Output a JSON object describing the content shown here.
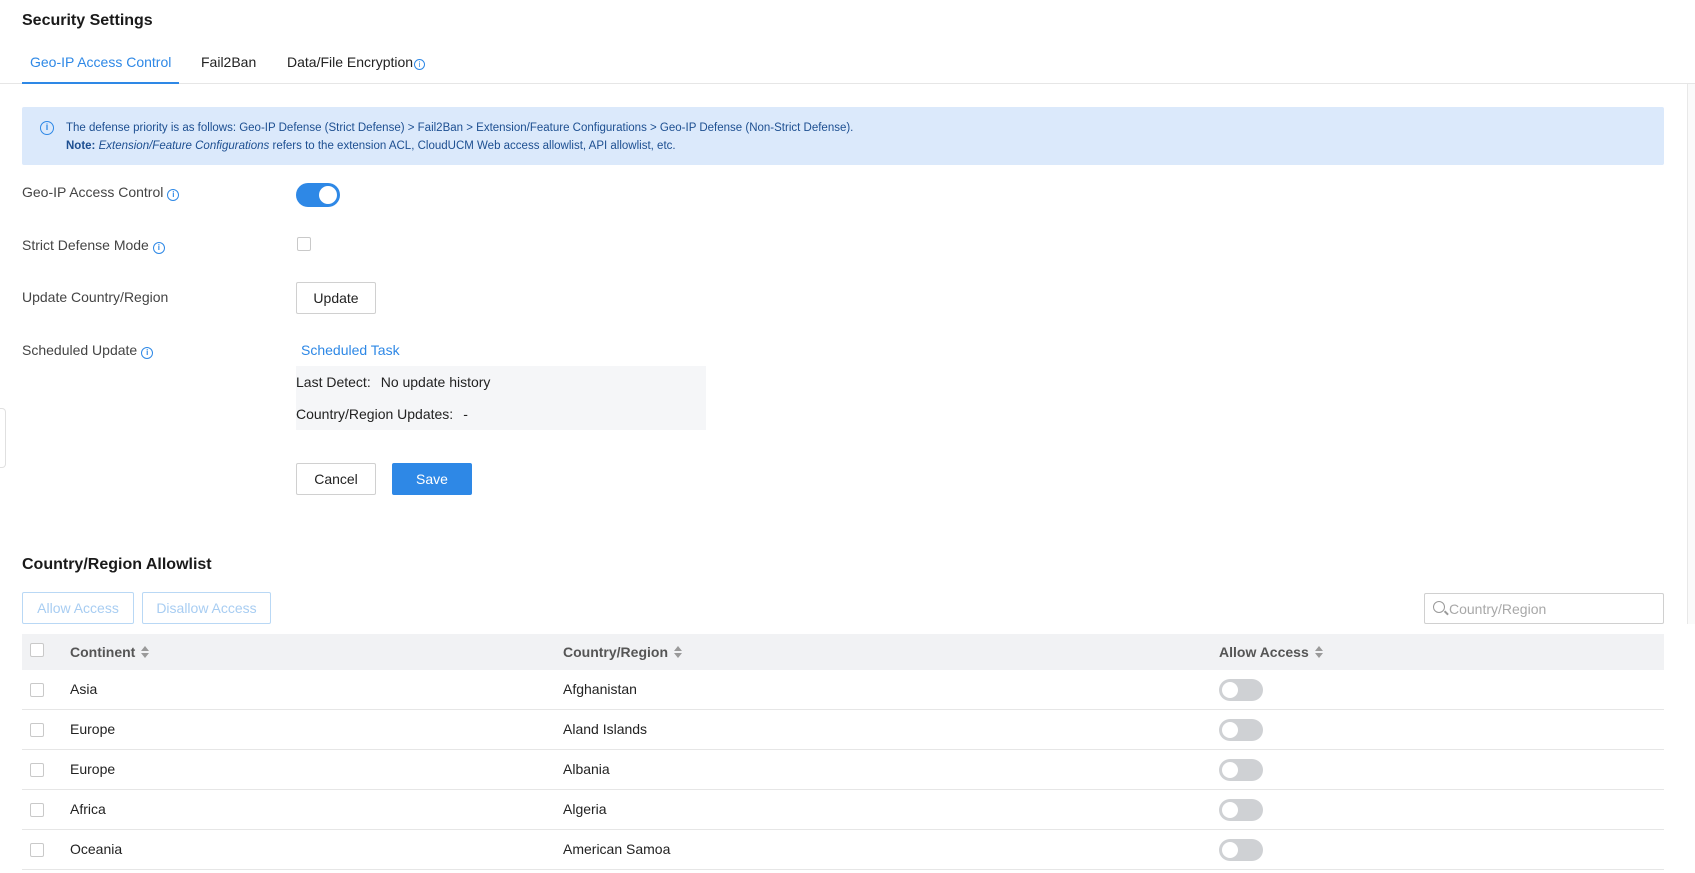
{
  "page": {
    "title": "Security Settings"
  },
  "tabs": [
    {
      "label": "Geo-IP Access Control"
    },
    {
      "label": "Fail2Ban"
    },
    {
      "label": "Data/File Encryption"
    }
  ],
  "notice": {
    "line1": "The defense priority is as follows: Geo-IP Defense (Strict Defense) > Fail2Ban > Extension/Feature Configurations > Geo-IP Defense (Non-Strict Defense).",
    "note_label": "Note:",
    "note_term": "Extension/Feature Configurations",
    "note_rest": "refers to the extension ACL, CloudUCM Web access allowlist, API allowlist, etc."
  },
  "form": {
    "geo_ip_label": "Geo-IP Access Control",
    "geo_ip_enabled": true,
    "strict_label": "Strict Defense Mode",
    "strict_checked": false,
    "update_label": "Update Country/Region",
    "update_button": "Update",
    "scheduled_label": "Scheduled Update",
    "scheduled_link": "Scheduled Task",
    "last_detect_label": "Last Detect:",
    "last_detect_value": "No update history",
    "updates_label": "Country/Region Updates:",
    "updates_value": "-",
    "cancel_button": "Cancel",
    "save_button": "Save"
  },
  "allowlist": {
    "title": "Country/Region Allowlist",
    "allow_button": "Allow Access",
    "disallow_button": "Disallow Access",
    "search_placeholder": "Country/Region",
    "columns": {
      "continent": "Continent",
      "country": "Country/Region",
      "allow": "Allow Access"
    },
    "rows": [
      {
        "continent": "Asia",
        "country": "Afghanistan",
        "allowed": false
      },
      {
        "continent": "Europe",
        "country": "Aland Islands",
        "allowed": false
      },
      {
        "continent": "Europe",
        "country": "Albania",
        "allowed": false
      },
      {
        "continent": "Africa",
        "country": "Algeria",
        "allowed": false
      },
      {
        "continent": "Oceania",
        "country": "American Samoa",
        "allowed": false
      }
    ]
  },
  "colors": {
    "accent": "#2e88e6",
    "notice_bg": "#dbe9fb",
    "toggle_off": "#cfd1d4"
  }
}
